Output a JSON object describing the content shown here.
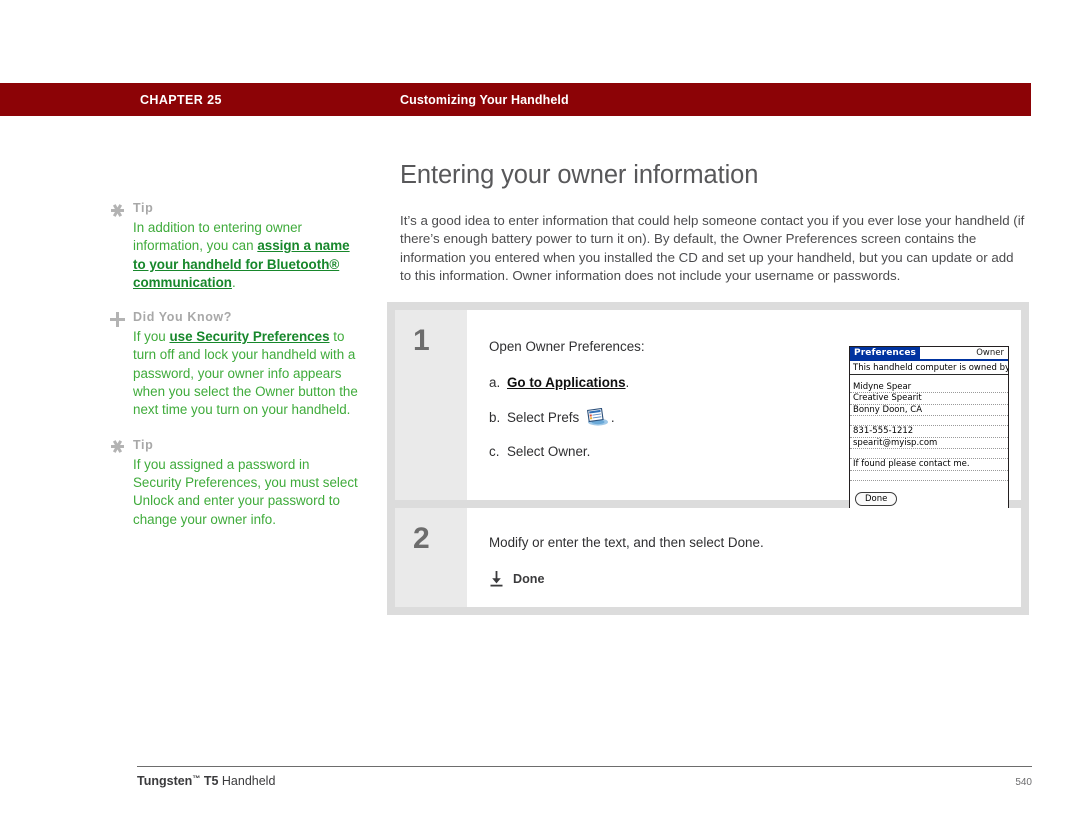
{
  "header": {
    "chapter_label": "CHAPTER 25",
    "chapter_title": "Customizing Your Handheld",
    "banner_color": "#8C0306"
  },
  "main": {
    "title": "Entering your owner information",
    "intro": "It’s a good idea to enter information that could help someone contact you if you ever lose your handheld (if there’s enough battery power to turn it on). By default, the Owner Preferences screen contains the information you entered when you installed the CD and set up your handheld, but you can update or add to this information. Owner information does not include your username or passwords."
  },
  "sidebar": {
    "tips": [
      {
        "icon": "asterisk-icon",
        "kicker": "Tip",
        "segments": [
          {
            "text": "In addition to entering owner information, you can ",
            "link": false
          },
          {
            "text": "assign a name to your handheld for Bluetooth® communication",
            "link": true
          },
          {
            "text": ".",
            "link": false
          }
        ]
      },
      {
        "icon": "plus-icon",
        "kicker": "Did You Know?",
        "segments": [
          {
            "text": "If you ",
            "link": false
          },
          {
            "text": "use Security Preferences",
            "link": true
          },
          {
            "text": " to turn off and lock your handheld with a password, your owner info appears when you select the Owner button the next time you turn on your handheld.",
            "link": false
          }
        ]
      },
      {
        "icon": "asterisk-icon",
        "kicker": "Tip",
        "segments": [
          {
            "text": "If you assigned a password in Security Preferences, you must select Unlock and enter your password to change your owner info.",
            "link": false
          }
        ]
      }
    ],
    "link_color": "#17872B",
    "text_color": "#3FAB3B"
  },
  "steps": [
    {
      "number": "1",
      "lead": "Open Owner Preferences:",
      "substeps": [
        {
          "marker": "a.",
          "pre": "",
          "link": "Go to Applications",
          "post": "."
        },
        {
          "marker": "b.",
          "pre": "Select Prefs ",
          "icon": "prefs-app-icon",
          "post": "."
        },
        {
          "marker": "c.",
          "pre": "Select Owner.",
          "post": ""
        }
      ]
    },
    {
      "number": "2",
      "lead": "Modify or enter the text, and then select Done.",
      "done": {
        "icon": "download-icon",
        "label": "Done"
      }
    }
  ],
  "pda": {
    "title_tab": "Preferences",
    "title_right": "Owner",
    "intro_line": "This handheld computer is owned by:",
    "fields": [
      "Midyne Spear",
      "Creative Spearit",
      "Bonny Doon, CA"
    ],
    "contact": [
      "831-555-1212",
      "spearit@myisp.com"
    ],
    "note": "If found please contact me.",
    "done_button": "Done",
    "accent_color": "#0033A0"
  },
  "footer": {
    "product_name": "Tungsten",
    "trademark": "™",
    "product_model": "T5",
    "product_kind": "Handheld",
    "page_number": "540"
  }
}
